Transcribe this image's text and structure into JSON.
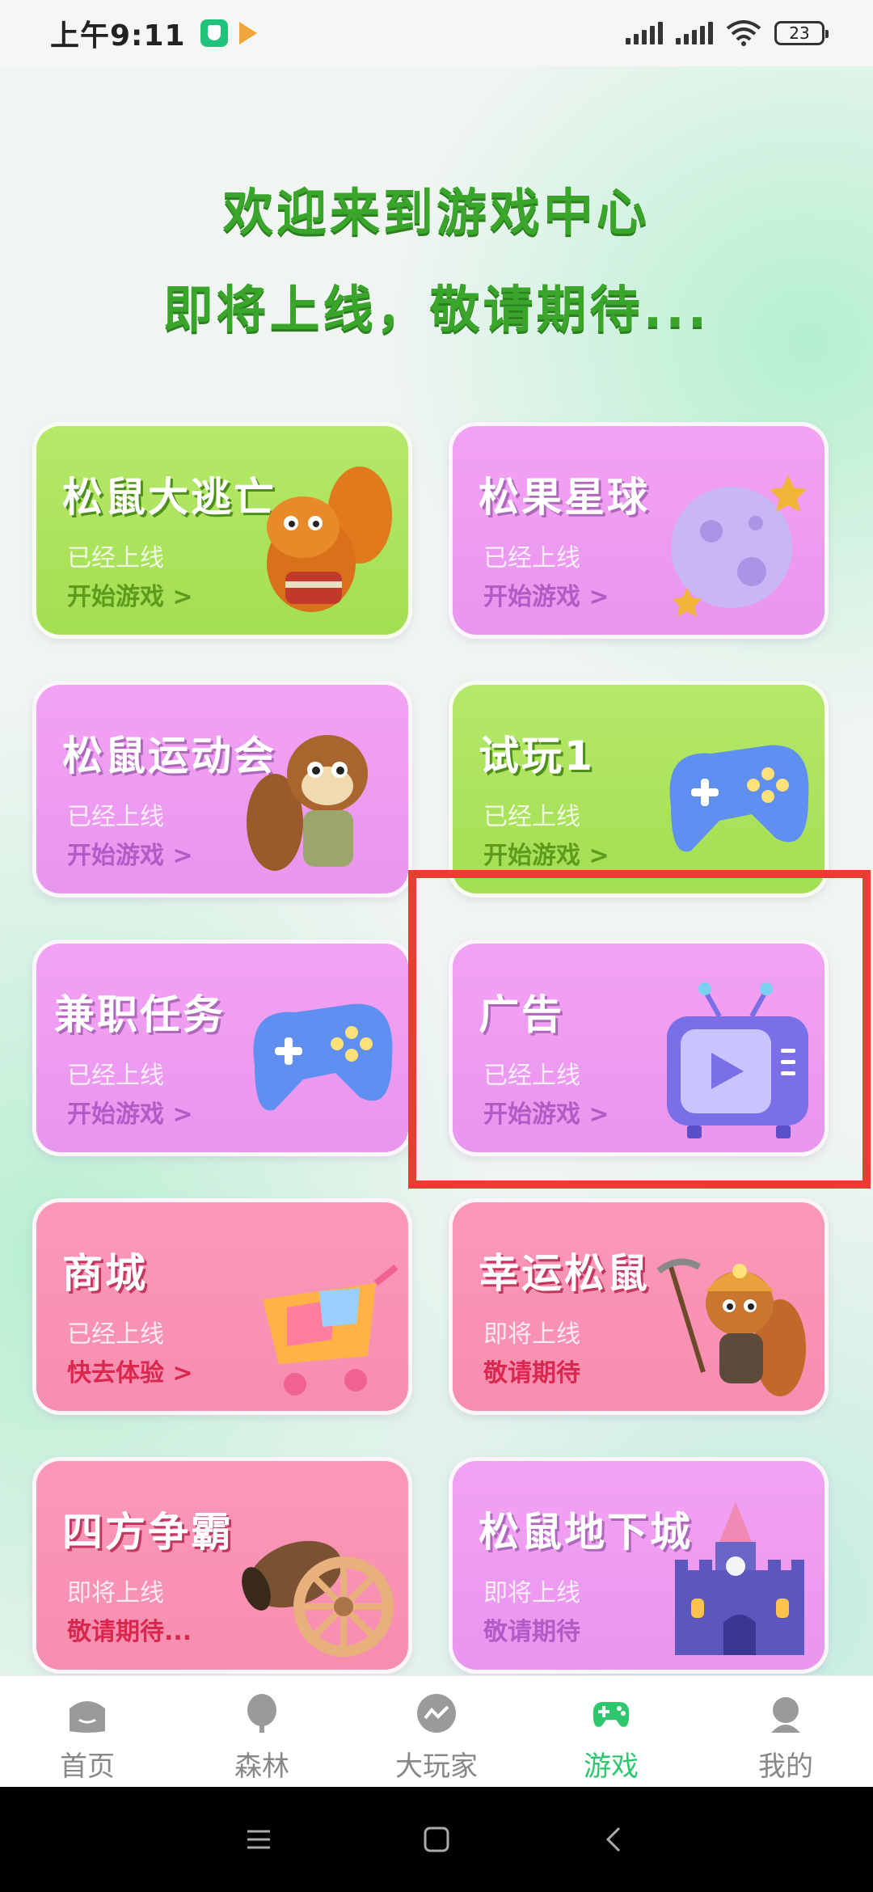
{
  "status_bar": {
    "time": "上午9:11",
    "battery": "23"
  },
  "hero": {
    "line1": "欢迎来到游戏中心",
    "line2": "即将上线，敬请期待..."
  },
  "cards": [
    {
      "title": "松鼠大逃亡",
      "status": "已经上线",
      "action": "开始游戏 >",
      "icon": "squirrel-running-icon"
    },
    {
      "title": "松果星球",
      "status": "已经上线",
      "action": "开始游戏 >",
      "icon": "planet-icon"
    },
    {
      "title": "松鼠运动会",
      "status": "已经上线",
      "action": "开始游戏 >",
      "icon": "squirrel-icon"
    },
    {
      "title": "试玩1",
      "status": "已经上线",
      "action": "开始游戏 >",
      "icon": "gamepad-icon"
    },
    {
      "title": "兼职任务",
      "status": "已经上线",
      "action": "开始游戏 >",
      "icon": "gamepad-icon"
    },
    {
      "title": "广告",
      "status": "已经上线",
      "action": "开始游戏 >",
      "icon": "tv-play-icon"
    },
    {
      "title": "商城",
      "status": "已经上线",
      "action": "快去体验 >",
      "icon": "shopping-cart-icon"
    },
    {
      "title": "幸运松鼠",
      "status": "即将上线",
      "action": "敬请期待",
      "icon": "miner-squirrel-icon"
    },
    {
      "title": "四方争霸",
      "status": "即将上线",
      "action": "敬请期待...",
      "icon": "cannon-icon"
    },
    {
      "title": "松鼠地下城",
      "status": "即将上线",
      "action": "敬请期待",
      "icon": "castle-icon"
    }
  ],
  "bottom_nav": [
    {
      "label": "首页",
      "icon": "home-icon"
    },
    {
      "label": "森林",
      "icon": "tree-icon"
    },
    {
      "label": "大玩家",
      "icon": "trend-icon"
    },
    {
      "label": "游戏",
      "icon": "gamepad-icon",
      "active": true
    },
    {
      "label": "我的",
      "icon": "profile-icon"
    }
  ],
  "colors": {
    "accent_green": "#2ec76d",
    "highlight_red": "#e53e33"
  }
}
